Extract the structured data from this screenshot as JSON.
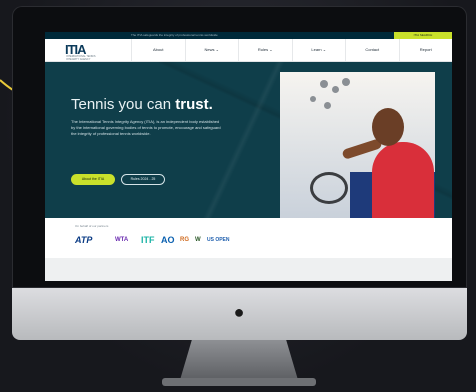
{
  "site": {
    "topbar_tagline": "The ITIA safeguards the integrity of professional tennis worldwide",
    "topbar_cta": "ITIA SEARCH"
  },
  "logo": {
    "text": "ITIA",
    "subtitle": "INTERNATIONAL TENNIS INTEGRITY AGENCY"
  },
  "nav": {
    "items": [
      "About",
      "News ⌄",
      "Rules ⌄",
      "Learn ⌄",
      "Contact",
      "Report"
    ]
  },
  "hero": {
    "title_prefix": "Tennis you can ",
    "title_emphasis": "trust.",
    "paragraph": "The International Tennis Integrity Agency (ITIA), is an independent body established by the international governing bodies of tennis to promote, encourage and safeguard the integrity of professional tennis worldwide.",
    "primary_button": "About the ITIA",
    "secondary_button": "Rules 2024 - 25"
  },
  "partners": {
    "label": "On behalf of our partners",
    "logos": [
      "ATP",
      "WTA",
      "ITF",
      "AO",
      "RG",
      "W",
      "US OPEN"
    ]
  },
  "colors": {
    "hero_bg": "#0f3e4a",
    "accent_lime": "#c9e02b",
    "brand_navy": "#0b3a5a",
    "arrow_yellow": "#e8c93a"
  }
}
